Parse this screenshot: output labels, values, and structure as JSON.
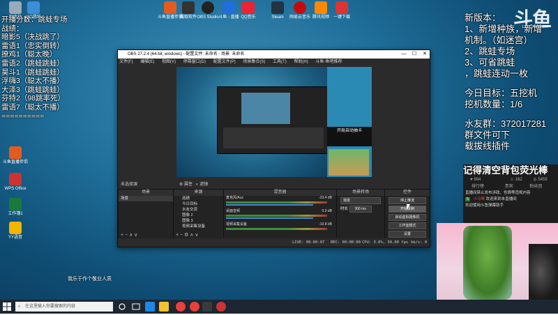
{
  "desktop": {
    "icons": [
      {
        "label": "回收站",
        "color": "#9ab"
      },
      {
        "label": "QQ游戏",
        "color": "#3b8fd6"
      },
      {
        "label": "斗鱼直播伴侣",
        "color": "#e35b1f"
      },
      {
        "label": "WPS Office",
        "color": "#c33"
      },
      {
        "label": "工作簿1",
        "color": "#1b7a3a"
      },
      {
        "label": "YY语音",
        "color": "#f2b500"
      }
    ],
    "top_icons": [
      {
        "label": "斗鱼直播伴侣",
        "color": "#e35b1f"
      },
      {
        "label": "截取软件",
        "color": "#333"
      },
      {
        "label": "OBS Studio",
        "color": "#222"
      },
      {
        "label": "斗鱼 - 直播",
        "color": "#1e6fd9"
      },
      {
        "label": "QQ音乐",
        "color": "#e23"
      },
      {
        "label": "Steam",
        "color": "#234"
      },
      {
        "label": "网易云音乐",
        "color": "#c20c0c"
      },
      {
        "label": "腾讯视频",
        "color": "#f80"
      },
      {
        "label": "一键下载",
        "color": "#d33"
      }
    ]
  },
  "left_overlay": {
    "lines": [
      "开播分数：跳蛙专场",
      "战绩：",
      "暗影5（决战跳了）",
      "雷语1（忠实倒转）",
      "撩鸡1（聪太晚）",
      "雷语2（跳蛙跳蛙）",
      "昊斗1（跳蛙跳蛙）",
      "浮嗨3（聪太不播）",
      "大泽3（跳蛙跳蛙）",
      "芬特2（98跳率死）",
      "雷语7（聪太不播）",
      "=========="
    ]
  },
  "right_overlay": {
    "logo": "斗鱼",
    "logo_sub": "DOUYU.COM",
    "lines": [
      "新版本：",
      "1、新增种族，新增",
      "机制。（如迷宫）",
      "2、跳蛙专场",
      "3、可省跳蛙",
      "，跳蛙连动一枚"
    ],
    "goal_lines": [
      "今日目标：五挖机",
      "挖机数量：1/6"
    ],
    "group_lines": [
      "水友群：372017281",
      "群文件可下",
      "载拔线插件"
    ]
  },
  "obs": {
    "title": "OBS 27.2.4 (64-bit, windows) - 配置文件: 未命名 - 场景: 未命名",
    "menu": [
      "文件(F)",
      "编辑(E)",
      "视图(V)",
      "停靠窗口(D)",
      "配置文件(P)",
      "场景集合(S)",
      "工具(T)",
      "帮助(H)",
      "斗鱼·鱼吧推荐"
    ],
    "scene_bar": {
      "label": "未选择源",
      "props": "属性",
      "filters": "滤镜"
    },
    "preview_text": "开局自动抽卡",
    "docks": {
      "scenes": {
        "header": "场景",
        "items": [
          "场景"
        ]
      },
      "sources": {
        "header": "来源",
        "items": [
          "战绩",
          "今日目标",
          "水友交流",
          "图像 2",
          "图像 3",
          "视频采集设备",
          "图像 1"
        ]
      },
      "mixer": {
        "header": "混音器",
        "rows": [
          {
            "name": "麦克风/Aux",
            "db": "-33.4 dB"
          },
          {
            "name": "桌面音频",
            "db": "0.0 dB"
          },
          {
            "name": "视频采集设备",
            "db": "-10.8 dB"
          }
        ]
      },
      "transitions": {
        "header": "场景转场",
        "type": "渐变",
        "duration_label": "时长",
        "duration": "300 ms"
      },
      "controls": {
        "header": "控件",
        "buttons": [
          "停止推流",
          "开始录制",
          "启动虚拟摄像机",
          "工作室模式",
          "设置",
          "退出"
        ]
      }
    },
    "status": {
      "live": "LIVE: 00:00:07",
      "rec": "REC: 00:00:00",
      "cpu": "CPU: 3.0%, 30.00 fps",
      "kbps": "kb/s: 0"
    }
  },
  "chat": {
    "title": "记得清空背包荧光棒",
    "stats": [
      "984",
      "162",
      "5459"
    ],
    "tabs": [
      "排行榜",
      "贵宾",
      "粉丝团"
    ],
    "system_msg": "直播间禁止发布涉政、色情等违规内容",
    "user_badge": "5",
    "user_msg": "欢迎来到本直播间",
    "user_prefix": "小马哥",
    "welcome": "欢迎使用斗鱼弹幕助手"
  },
  "bottom_text": "我乐于作个敬业人质",
  "taskbar": {
    "search_placeholder": "在这里输入你要搜索的内容"
  }
}
